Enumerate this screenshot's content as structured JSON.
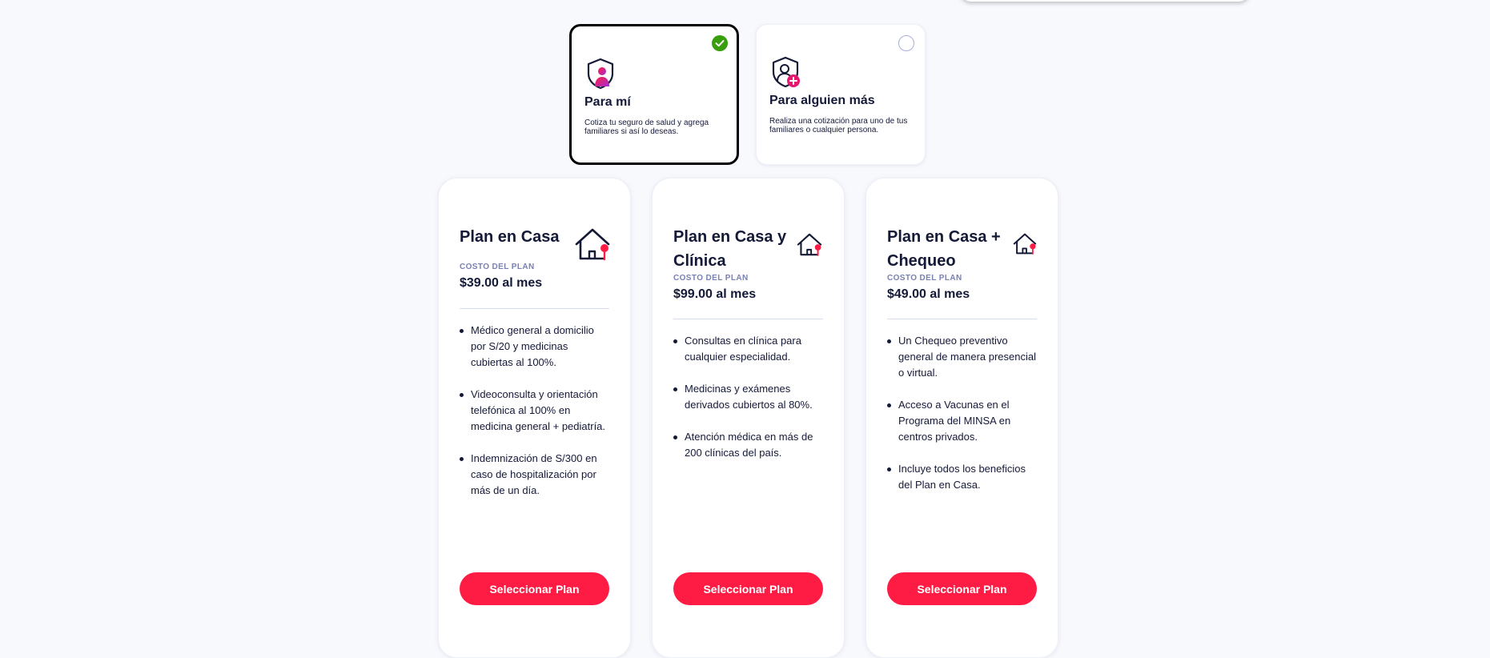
{
  "selector": {
    "options": [
      {
        "title": "Para mí",
        "description": "Cotiza tu seguro de salud y agrega familiares si así lo deseas.",
        "selected": true,
        "icon": "shield-user-icon"
      },
      {
        "title": "Para alguien más",
        "description": "Realiza una cotización para uno de tus familiares o cualquier persona.",
        "selected": false,
        "icon": "shield-user-add-icon"
      }
    ]
  },
  "plans": [
    {
      "title": "Plan en Casa",
      "price_label": "COSTO DEL PLAN",
      "price": "$39.00 al mes",
      "icon": "house-pin-icon",
      "benefits": [
        "Médico general a domicilio por S/20 y medicinas cubiertas al 100%.",
        "Videoconsulta y orientación telefónica al 100% en medicina general + pediatría.",
        "Indemnización de S/300 en caso de hospitalización por más de un día."
      ],
      "button_label": "Seleccionar Plan"
    },
    {
      "title": "Plan en Casa y Clínica",
      "price_label": "COSTO DEL PLAN",
      "price": "$99.00 al mes",
      "icon": "house-pin-icon",
      "benefits": [
        "Consultas en clínica para cualquier especialidad.",
        "Medicinas y exámenes derivados cubiertos al 80%.",
        "Atención médica en más de 200 clínicas del país."
      ],
      "button_label": "Seleccionar Plan"
    },
    {
      "title": "Plan en Casa + Chequeo",
      "price_label": "COSTO DEL PLAN",
      "price": "$49.00 al mes",
      "icon": "house-pin-icon",
      "benefits": [
        "Un Chequeo preventivo general de manera presencial o virtual.",
        "Acceso a Vacunas en el Programa del MINSA en centros privados.",
        "Incluye todos los beneficios del Plan en Casa."
      ],
      "button_label": "Seleccionar Plan"
    }
  ],
  "colors": {
    "page_background": "#f8f9fd",
    "primary_button": "#ff1c44",
    "selected_check": "#389e0d",
    "text_dark": "#141938",
    "label_muted": "#7981b2"
  }
}
